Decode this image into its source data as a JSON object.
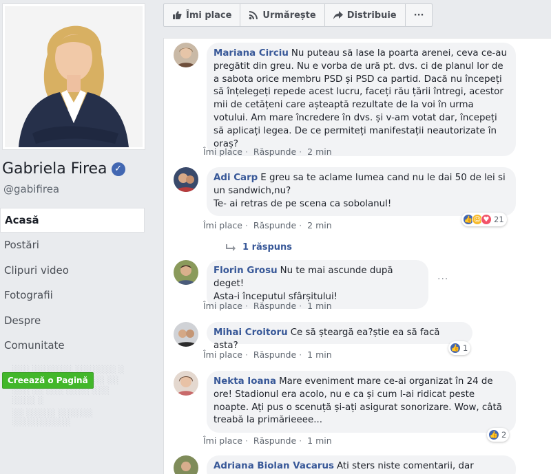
{
  "page": {
    "name": "Gabriela Firea",
    "username": "@gabifirea",
    "verified_icon": "verified-check-icon"
  },
  "nav": {
    "items": [
      {
        "label": "Acasă",
        "active": true
      },
      {
        "label": "Postări"
      },
      {
        "label": "Clipuri video"
      },
      {
        "label": "Fotografii"
      },
      {
        "label": "Despre"
      },
      {
        "label": "Comunitate"
      }
    ],
    "create_page": "Creează o Pagină"
  },
  "actions": {
    "like": "Îmi place",
    "follow": "Urmărește",
    "share": "Distribuie",
    "more": "···"
  },
  "comment_actions": {
    "like": "Îmi place",
    "reply": "Răspunde"
  },
  "comments": [
    {
      "author": "Mariana Circiu",
      "text": "Nu puteau să lase la poarta arenei, ceva ce-au pregătit din greu. Nu e vorba de ură pt. dvs. ci de planul lor de a sabota orice membru PSD și PSD ca partid. Dacă nu începeți să înțelegeți repede acest lucru, faceți rău țării întregi, acestor mii de cetățeni care așteaptă rezultate de la voi în urma votului. Am mare încredere în dvs. și v-am votat dar, începeți să aplicați legea. De ce permiteți manifestații neautorizate în oraș?",
      "time": "2 min"
    },
    {
      "author": "Adi Carp",
      "text": "E greu sa te aclame lumea cand nu le dai 50 de lei si un sandwich,nu?",
      "text2": "Te- ai retras de pe scena ca sobolanul!",
      "time": "2 min",
      "reactions": "21",
      "replies": "1 răspuns"
    },
    {
      "author": "Florin Grosu",
      "text": "Nu te mai ascunde după deget!",
      "text2": "Asta-i începutul sfârșitului!",
      "time": "1 min",
      "more": "···"
    },
    {
      "author": "Mihai Croitoru",
      "text": "Ce să șteargă ea?știe ea să facă asta?",
      "time": "1 min",
      "reactions": "1"
    },
    {
      "author": "Nekta Ioana",
      "text": "Mare eveniment mare ce-ai organizat în 24 de ore! Stadionul era acolo, nu e ca și cum l-ai ridicat peste noapte. Ați pus o scenuță și-ați asigurat sonorizare. Wow, câtă treabă la primărieeee...",
      "time": "1 min",
      "reactions": "2"
    },
    {
      "author": "Adriana Biolan Vacarus",
      "text": "Ati sters niste comentarii, dar oamenii",
      "time": ""
    }
  ],
  "colors": {
    "link_blue": "#385898",
    "like_blue": "#4267b2",
    "green": "#42b72a",
    "haha_yellow": "#f7b928",
    "angry_orange": "#e9710f",
    "love_red": "#f25268"
  }
}
